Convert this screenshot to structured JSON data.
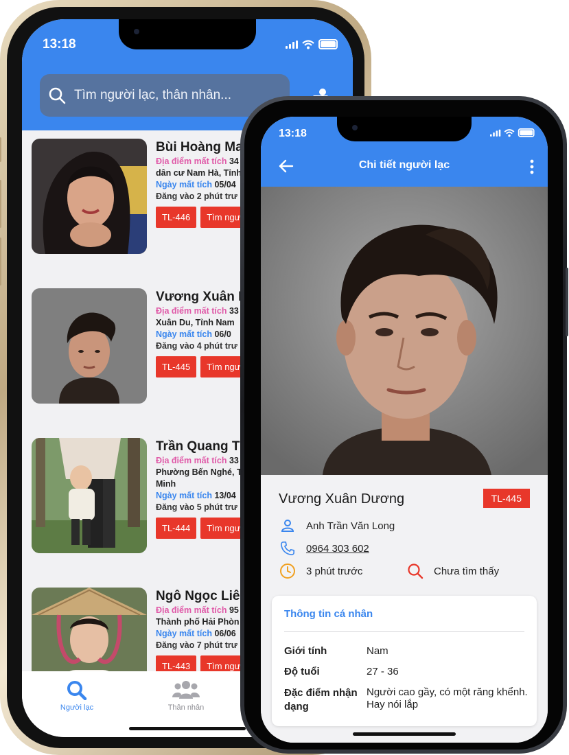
{
  "back_app": {
    "status": {
      "time": "13:18"
    },
    "search": {
      "placeholder": "Tìm người lạc, thân nhân..."
    },
    "labels": {
      "location": "Địa điểm mất tích",
      "date": "Ngày mất tích"
    },
    "cards": [
      {
        "name": "Bùi Hoàng Mai",
        "location_value": "34",
        "location_cont": "dân cư Nam Hà, Tỉnh",
        "location_cont2": "",
        "date_value": "05/04",
        "posted": "Đăng vào 2 phút trư",
        "tag": "TL-446",
        "action": "Tìm ngư"
      },
      {
        "name": "Vương Xuân Dư",
        "location_value": "33",
        "location_cont": "Xuân Du, Tỉnh Nam",
        "location_cont2": "",
        "date_value": "06/0",
        "posted": "Đăng vào 4 phút trư",
        "tag": "TL-445",
        "action": "Tìm ngư"
      },
      {
        "name": "Trần Quang Tú",
        "location_value": "33",
        "location_cont": "Phường Bến Nghé, T",
        "location_cont2": "Minh",
        "date_value": "13/04",
        "posted": "Đăng vào 5 phút trư",
        "tag": "TL-444",
        "action": "Tìm ngư"
      },
      {
        "name": "Ngô Ngọc Liên",
        "location_value": "95",
        "location_cont": "Thành phố Hải Phòn",
        "location_cont2": "",
        "date_value": "06/06",
        "posted": "Đăng vào 7 phút trư",
        "tag": "TL-443",
        "action": "Tìm ngư"
      }
    ],
    "tabs": [
      {
        "label": "Người lạc",
        "icon": "search-icon",
        "active": true
      },
      {
        "label": "Thân nhân",
        "icon": "people-icon",
        "active": false
      }
    ],
    "colors": {
      "primary": "#3a86ee",
      "tag": "#e8372a",
      "pink": "#e05aa8"
    }
  },
  "front_app": {
    "status": {
      "time": "13:18"
    },
    "header": {
      "title": "Chi tiết người lạc"
    },
    "person": {
      "name": "Vương Xuân Dương",
      "tag": "TL-445",
      "reporter": "Anh Trần Văn Long",
      "phone": "0964 303 602",
      "time_ago": "3 phút trước",
      "status": "Chưa tìm thấy"
    },
    "personal_info": {
      "title": "Thông tin cá nhân",
      "rows": [
        {
          "key": "Giới tính",
          "value": "Nam"
        },
        {
          "key": "Độ tuổi",
          "value": "27 - 36"
        },
        {
          "key": "Đặc điểm nhận dạng",
          "value": "Người cao gầy, có một răng khểnh. Hay nói lắp"
        }
      ]
    }
  }
}
